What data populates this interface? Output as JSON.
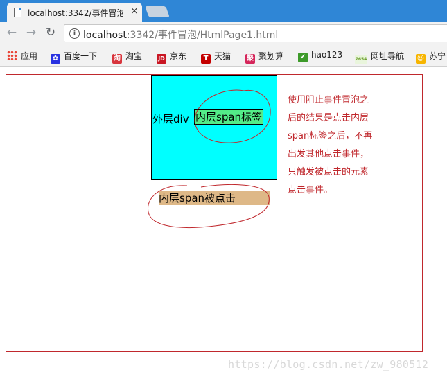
{
  "browser": {
    "tab": {
      "title": "localhost:3342/事件冒泡",
      "close_glyph": "×",
      "icon": "page-icon"
    },
    "nav": {
      "back_glyph": "←",
      "forward_glyph": "→",
      "reload_glyph": "↻"
    },
    "address": {
      "host": "localhost",
      "rest": ":3342/事件冒泡/HtmlPage1.html",
      "info_glyph": "i"
    },
    "bookmarks": [
      {
        "label": "应用",
        "icon": "apps-grid-icon",
        "color": "#e84335"
      },
      {
        "label": "百度一下",
        "icon": "baidu-paw-icon",
        "color": "#2932e1",
        "glyph": "✿"
      },
      {
        "label": "淘宝",
        "icon": "taobao-icon",
        "color": "#d8353d",
        "glyph": "淘"
      },
      {
        "label": "京东",
        "icon": "jd-icon",
        "color": "#c91623",
        "glyph": "JD"
      },
      {
        "label": "天猫",
        "icon": "tmall-icon",
        "color": "#c40000",
        "glyph": "T"
      },
      {
        "label": "聚划算",
        "icon": "juhuasuan-icon",
        "color": "#d5265b",
        "glyph": "聚"
      },
      {
        "label": "hao123",
        "icon": "hao123-icon",
        "color": "#3d9a2a",
        "glyph": "✔"
      },
      {
        "label": "网址导航",
        "icon": "7654-icon",
        "color": "#8bc34a",
        "glyph": "7654"
      },
      {
        "label": "苏宁",
        "icon": "suning-icon",
        "color": "#f7b500",
        "glyph": "☺"
      }
    ]
  },
  "page": {
    "outer_div_label": "外层div",
    "inner_span_label": "内层span标签",
    "result_text": "内层span被点击",
    "annotation": "使用阻止事件冒泡之\n后的结果是点击内层\nspan标签之后，不再\n出发其他点击事件，\n只触发被点击的元素\n点击事件。",
    "watermark": "https://blog.csdn.net/zw_980512"
  },
  "colors": {
    "chrome_blue": "#2f86d6",
    "frame_red": "#c0282d",
    "outer_div_bg": "#00ffff",
    "inner_span_bg": "#53ec88",
    "result_bg": "#deb887"
  }
}
